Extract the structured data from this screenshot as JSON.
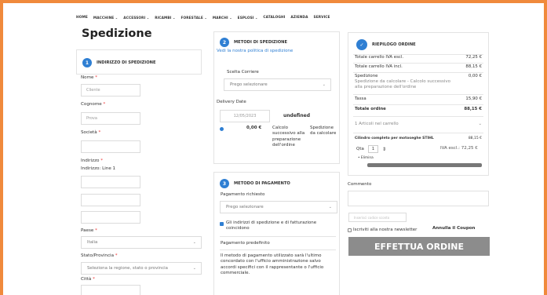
{
  "nav": [
    "HOME",
    "MACCHINE",
    "ACCESSORI",
    "RICAMBI",
    "FORESTALE",
    "MARCHI",
    "ESPLOSI",
    "CATALOGHI",
    "AZIENDA",
    "SERVICE"
  ],
  "title": "Spedizione",
  "address": {
    "step_num": "1",
    "heading": "INDIRIZZO DI SPEDIZIONE",
    "nome_label": "Nome",
    "nome_value": "Cliente",
    "cognome_label": "Cognome",
    "cognome_value": "Prova",
    "societa_label": "Società",
    "indirizzo_label": "Indirizzo",
    "indirizzo_line1": "Indirizzo: Line 1",
    "paese_label": "Paese",
    "paese_value": "Italia",
    "stato_label": "Stato/Provincia",
    "stato_value": "Seleziona la regione, stato o provincia",
    "citta_label": "Città"
  },
  "shipping": {
    "step_num": "2",
    "heading": "METODI DI SPEDIZIONE",
    "policy_link": "Vedi la nostra politica di spedizione",
    "courier_label": "Scelta Corriere",
    "courier_value": "Prego selezionare",
    "delivery_label": "Delivery Date",
    "delivery_value": "12/05/2023",
    "delivery_extra": "undefined",
    "price": "0,00 €",
    "calc": "Calcolo successivo alla preparazione dell'ordine",
    "desc": "Spedizione da calcolare"
  },
  "payment": {
    "step_num": "3",
    "heading": "METODO DI PAGAMENTO",
    "requested_label": "Pagamento richiesto",
    "requested_value": "Prego selezionare",
    "same_address": "Gli indirizzi di spedizione e di fatturazione coincidono",
    "default_label": "Pagamento predefinito",
    "default_text": "Il metodo di pagamento utilizzato sarà l'ultimo concordato con l'ufficio amministrazione salvo accordi specifici con il rappresentante o l'ufficio commerciale."
  },
  "summary": {
    "heading": "RIEPILOGO ORDINE",
    "rows": [
      {
        "label": "Totale carrello IVA escl.",
        "value": "72,25 €"
      },
      {
        "label": "Totale carrello IVA incl.",
        "value": "88,15 €"
      }
    ],
    "shipping_label": "Spedizione",
    "shipping_value": "0,00 €",
    "shipping_note": "Spedizione da calcolare - Calcolo successivo alla preparazione dell'ordine",
    "tax_label": "Tassa",
    "tax_value": "15,90 €",
    "total_label": "Totale ordine",
    "total_value": "88,15 €",
    "items_label": "1 Articoli nel carrello",
    "product_name": "Cilindro completo per motoseghe STIHL",
    "product_price": "88,15 €",
    "qty_label": "Qta",
    "qty_value": "1",
    "product_price_ex": "IVA escl.: 72,25 €",
    "remove_label": "Elimina"
  },
  "comment_label": "Commento",
  "coupon_placeholder": "Inserisci codice sconto",
  "coupon_cancel": "Annulla il Coupon",
  "newsletter_label": "Iscriviti alla nostra newsletter",
  "checkout_label": "EFFETTUA ORDINE"
}
